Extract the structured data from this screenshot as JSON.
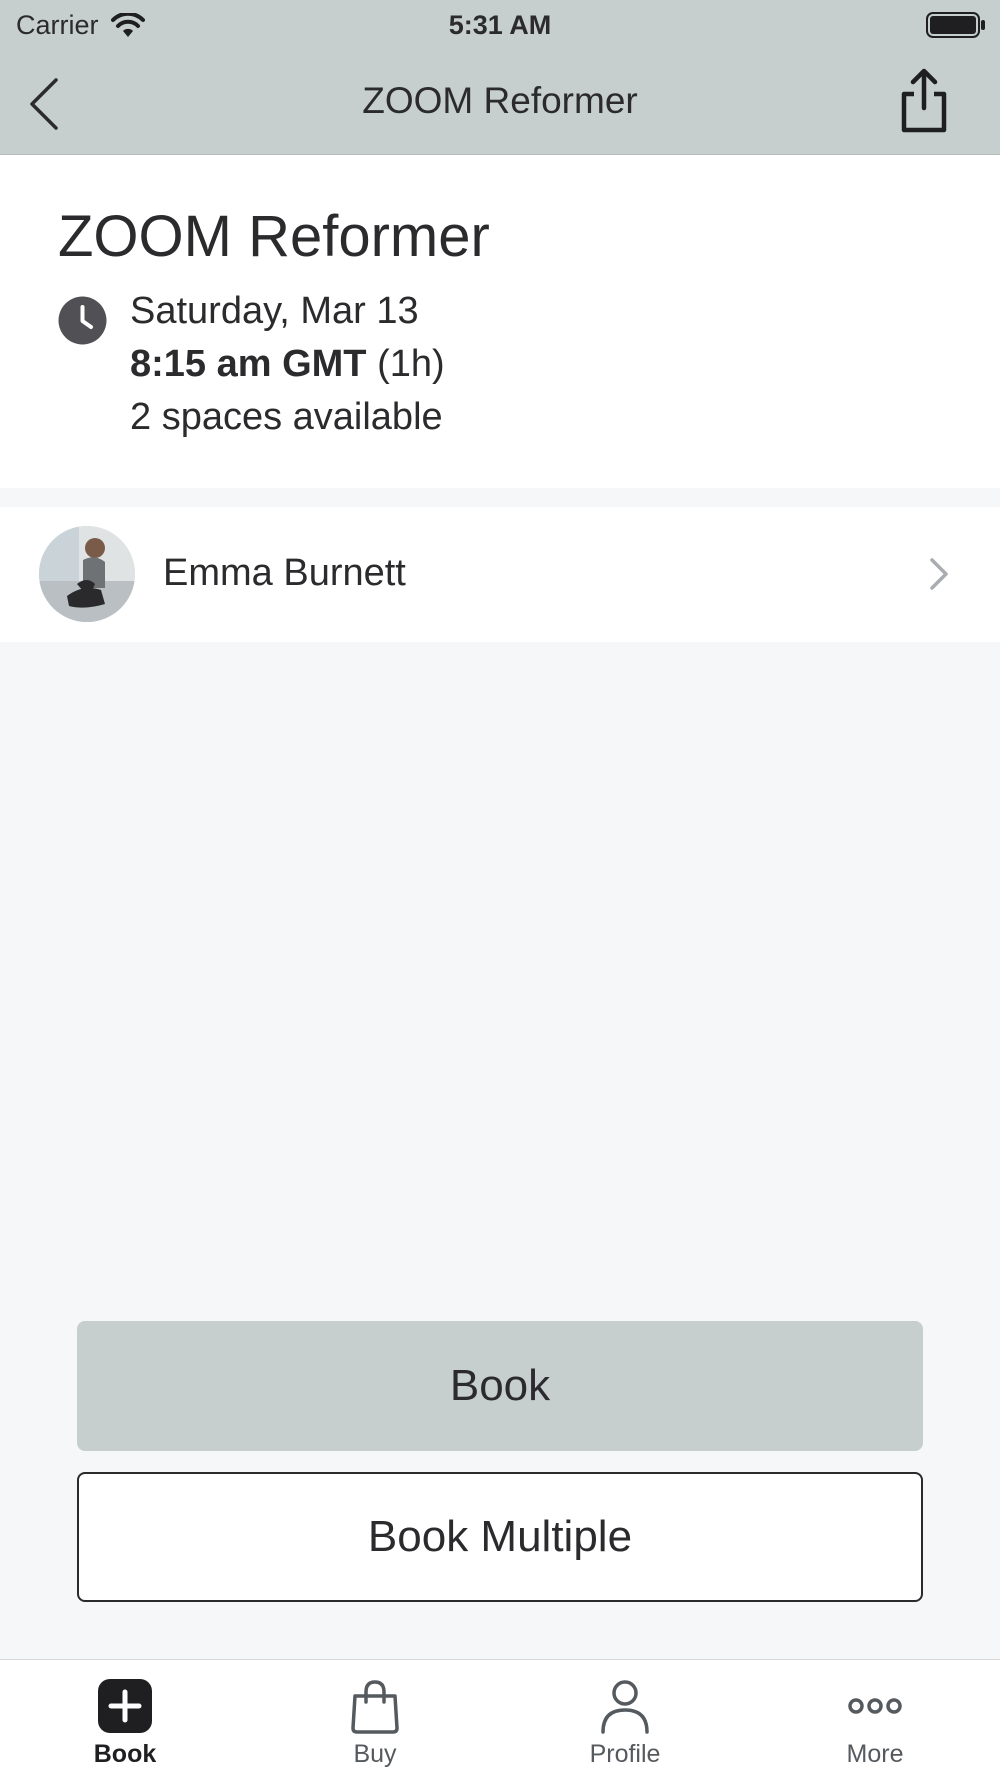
{
  "status_bar": {
    "carrier": "Carrier",
    "time": "5:31 AM"
  },
  "nav": {
    "title": "ZOOM Reformer",
    "back_icon": "chevron-left-icon",
    "share_icon": "share-icon"
  },
  "class": {
    "title": "ZOOM Reformer",
    "date": "Saturday, Mar 13",
    "time": "8:15 am GMT",
    "duration": "(1h)",
    "spaces": "2 spaces available"
  },
  "instructor": {
    "name": "Emma Burnett"
  },
  "actions": {
    "book_label": "Book",
    "book_multiple_label": "Book Multiple"
  },
  "tabs": [
    {
      "label": "Book",
      "icon": "plus-square-icon",
      "active": true
    },
    {
      "label": "Buy",
      "icon": "shopping-bag-icon",
      "active": false
    },
    {
      "label": "Profile",
      "icon": "person-icon",
      "active": false
    },
    {
      "label": "More",
      "icon": "more-dots-icon",
      "active": false
    }
  ],
  "colors": {
    "header_bg": "#c6cfcd",
    "primary_button": "#c6cfcd",
    "text": "#2b2b2e",
    "page_bg": "#f6f7f9"
  }
}
